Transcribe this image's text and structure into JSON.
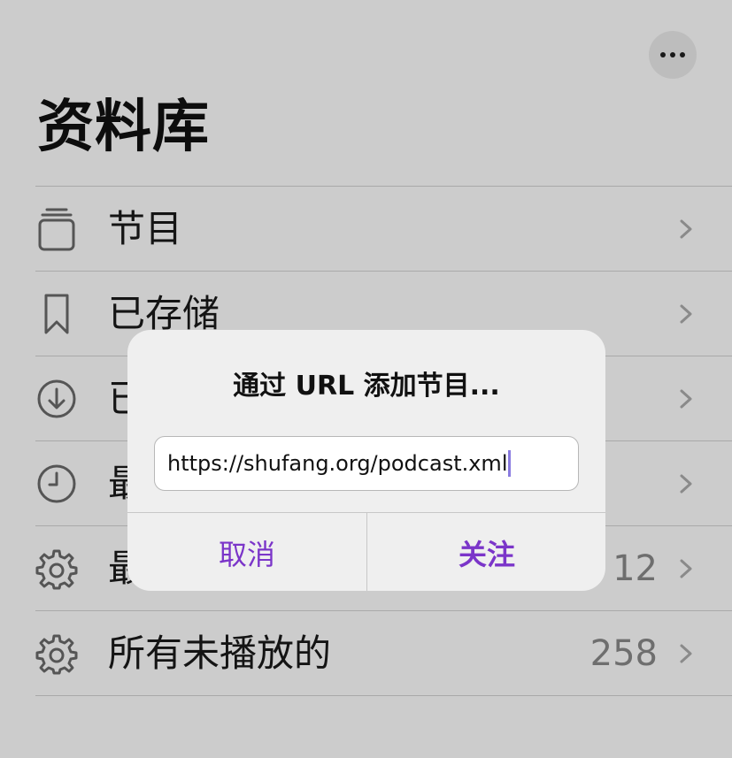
{
  "header": {
    "title": "资料库",
    "more_icon": "ellipsis-icon"
  },
  "list": {
    "items": [
      {
        "label": "节目",
        "icon": "stack-icon",
        "count": ""
      },
      {
        "label": "已存储",
        "icon": "bookmark-icon",
        "count": ""
      },
      {
        "label": "已",
        "icon": "download-icon",
        "count": ""
      },
      {
        "label": "最",
        "icon": "clock-icon",
        "count": ""
      },
      {
        "label": "最",
        "icon": "gear-icon",
        "count": "12"
      },
      {
        "label": "所有未播放的",
        "icon": "gear-icon",
        "count": "258"
      }
    ]
  },
  "dialog": {
    "title": "通过 URL 添加节目...",
    "url_value": "https://shufang.org/podcast.xml",
    "cancel_label": "取消",
    "follow_label": "关注"
  },
  "colors": {
    "accent": "#7b35c9",
    "background": "#cccccc",
    "dialog_bg": "#efefef"
  }
}
